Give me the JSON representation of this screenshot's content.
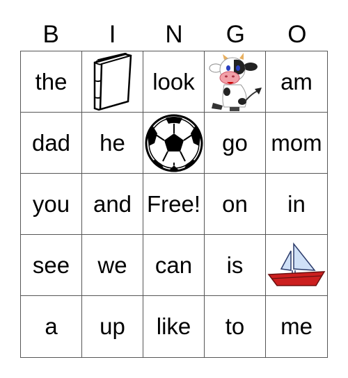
{
  "header": [
    "B",
    "I",
    "N",
    "G",
    "O"
  ],
  "rows": [
    [
      {
        "text": "the"
      },
      {
        "icon": "book-icon"
      },
      {
        "text": "look"
      },
      {
        "icon": "cow-icon"
      },
      {
        "text": "am"
      }
    ],
    [
      {
        "text": "dad"
      },
      {
        "text": "he"
      },
      {
        "icon": "soccer-ball-icon"
      },
      {
        "text": "go"
      },
      {
        "text": "mom"
      }
    ],
    [
      {
        "text": "you"
      },
      {
        "text": "and"
      },
      {
        "text": "Free!"
      },
      {
        "text": "on"
      },
      {
        "text": "in"
      }
    ],
    [
      {
        "text": "see"
      },
      {
        "text": "we"
      },
      {
        "text": "can"
      },
      {
        "text": "is"
      },
      {
        "icon": "sailboat-icon"
      }
    ],
    [
      {
        "text": "a"
      },
      {
        "text": "up"
      },
      {
        "text": "like"
      },
      {
        "text": "to"
      },
      {
        "text": "me"
      }
    ]
  ],
  "colors": {
    "grid_line": "#555555",
    "boat_hull": "#cc1f1f",
    "boat_sail": "#cfe0f7",
    "cow_nose": "#f2a0a8",
    "cow_horn": "#e8b060"
  }
}
